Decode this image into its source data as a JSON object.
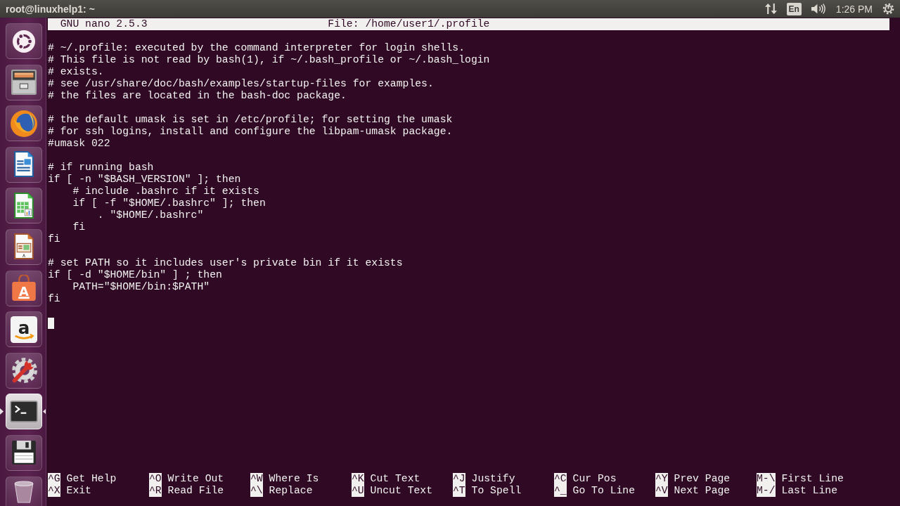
{
  "top_panel": {
    "title": "root@linuxhelp1: ~",
    "keyboard_layout": "En",
    "clock": "1:26 PM"
  },
  "launcher": [
    {
      "kind": "dash",
      "selected": false
    },
    {
      "kind": "files",
      "selected": false
    },
    {
      "kind": "browser",
      "selected": false
    },
    {
      "kind": "writer",
      "selected": false
    },
    {
      "kind": "calc",
      "selected": false
    },
    {
      "kind": "impress",
      "selected": false
    },
    {
      "kind": "store",
      "glyph": "A",
      "selected": false
    },
    {
      "kind": "shop",
      "glyph": "a",
      "selected": false
    },
    {
      "kind": "settings",
      "selected": false
    },
    {
      "kind": "terminal",
      "selected": true
    },
    {
      "kind": "disk",
      "selected": false
    },
    {
      "kind": "trash",
      "selected": false
    }
  ],
  "editor": {
    "version": "GNU nano 2.5.3",
    "file": "File: /home/user1/.profile",
    "blocks": [
      [
        "# ~/.profile: executed by the command interpreter for login shells.",
        "# This file is not read by bash(1), if ~/.bash_profile or ~/.bash_login",
        "# exists.",
        "# see /usr/share/doc/bash/examples/startup-files for examples.",
        "# the files are located in the bash-doc package."
      ],
      [
        "# the default umask is set in /etc/profile; for setting the umask",
        "# for ssh logins, install and configure the libpam-umask package.",
        "#umask 022"
      ],
      [
        "# if running bash",
        "if [ -n \"$BASH_VERSION\" ]; then",
        "    # include .bashrc if it exists",
        "    if [ -f \"$HOME/.bashrc\" ]; then",
        "        . \"$HOME/.bashrc\"",
        "    fi",
        "fi"
      ],
      [
        "# set PATH so it includes user's private bin if it exists",
        "if [ -d \"$HOME/bin\" ] ; then",
        "    PATH=\"$HOME/bin:$PATH\"",
        "fi"
      ]
    ],
    "shortcuts": [
      {
        "key": "^G",
        "label": "Get Help"
      },
      {
        "key": "^O",
        "label": "Write Out"
      },
      {
        "key": "^W",
        "label": "Where Is"
      },
      {
        "key": "^K",
        "label": "Cut Text"
      },
      {
        "key": "^J",
        "label": "Justify"
      },
      {
        "key": "^C",
        "label": "Cur Pos"
      },
      {
        "key": "^Y",
        "label": "Prev Page"
      },
      {
        "key": "M-\\",
        "label": "First Line"
      },
      {
        "key": "^X",
        "label": "Exit"
      },
      {
        "key": "^R",
        "label": "Read File"
      },
      {
        "key": "^\\",
        "label": "Replace"
      },
      {
        "key": "^U",
        "label": "Uncut Text"
      },
      {
        "key": "^T",
        "label": "To Spell"
      },
      {
        "key": "^_",
        "label": "Go To Line"
      },
      {
        "key": "^V",
        "label": "Next Page"
      },
      {
        "key": "M-/",
        "label": "Last Line"
      }
    ]
  }
}
